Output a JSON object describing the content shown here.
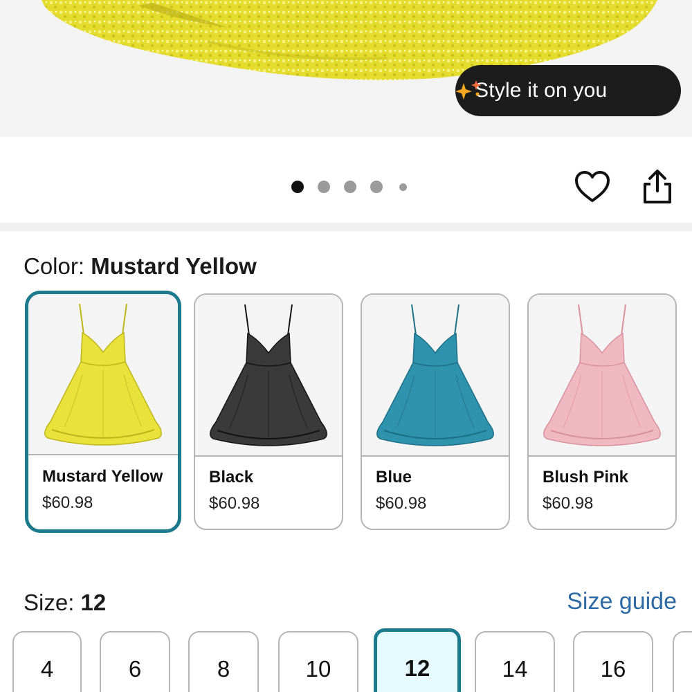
{
  "hero": {
    "style_button_label": "Style it on you"
  },
  "gallery": {
    "dot_count": 5,
    "active_dot": 0
  },
  "color": {
    "label": "Color:",
    "selected": "Mustard Yellow",
    "options": [
      {
        "name": "Mustard Yellow",
        "price": "$60.98",
        "color": "#e8e23a",
        "dark": "#bdb51a",
        "selected": true
      },
      {
        "name": "Black",
        "price": "$60.98",
        "color": "#3a3a3a",
        "dark": "#141414",
        "selected": false
      },
      {
        "name": "Blue",
        "price": "$60.98",
        "color": "#2f93ad",
        "dark": "#1c6f86",
        "selected": false
      },
      {
        "name": "Blush Pink",
        "price": "$60.98",
        "color": "#f0b9c1",
        "dark": "#d8919c",
        "selected": false
      }
    ]
  },
  "size": {
    "label": "Size:",
    "selected": "12",
    "guide_label": "Size guide",
    "options": [
      "4",
      "6",
      "8",
      "10",
      "12",
      "14",
      "16"
    ]
  },
  "colors": {
    "accent": "#1b7a8c",
    "link": "#2d6aa3",
    "pill_bg": "#1c1c1c"
  },
  "icons": [
    "sparkle-icon",
    "heart-icon",
    "share-icon"
  ]
}
